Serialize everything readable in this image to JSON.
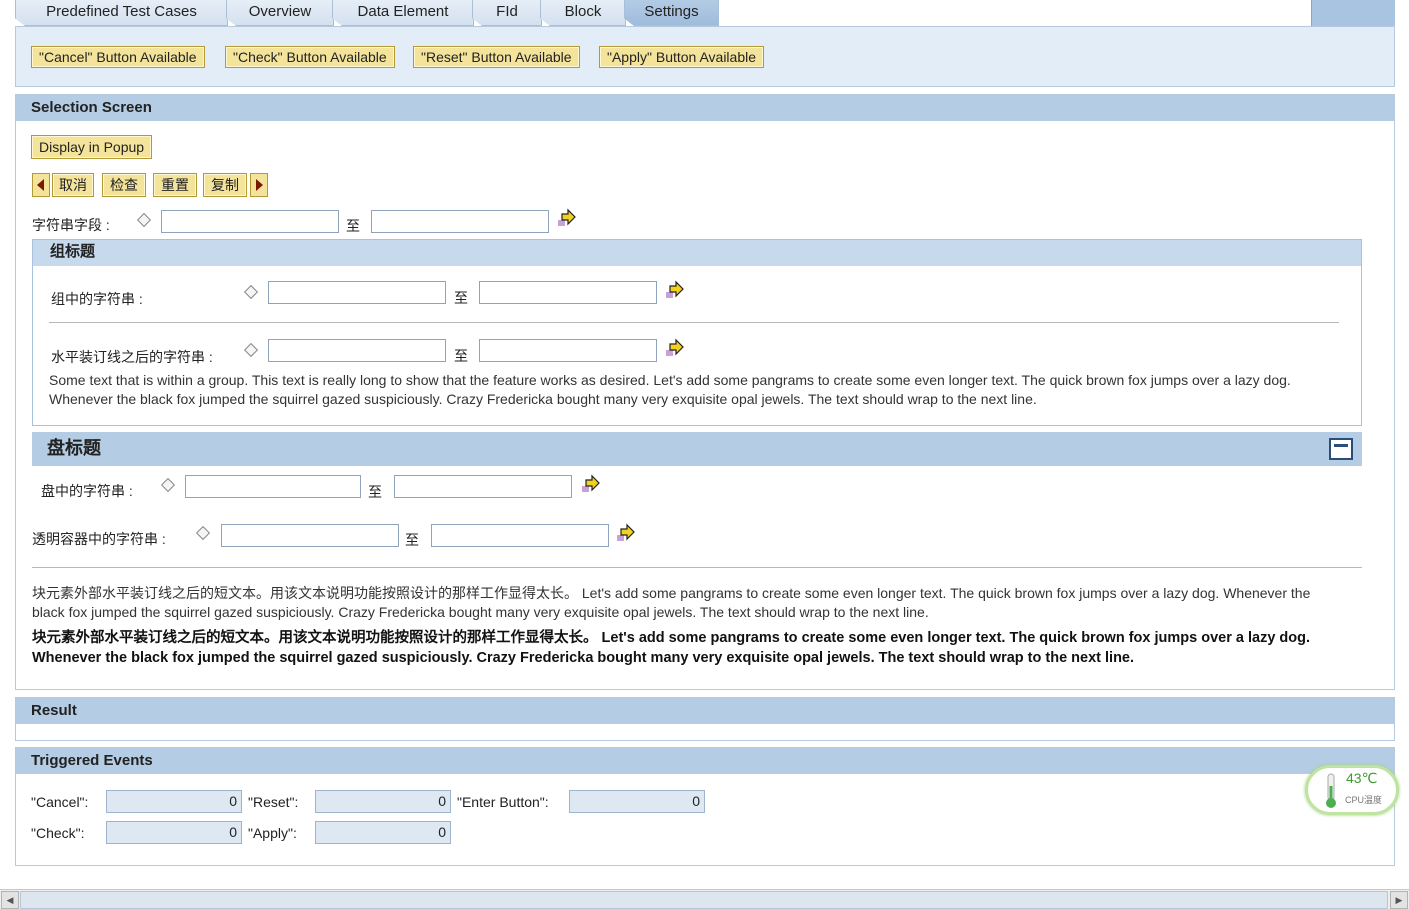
{
  "tabs": [
    {
      "label": "Predefined Test Cases"
    },
    {
      "label": "Overview"
    },
    {
      "label": "Data Element"
    },
    {
      "label": "FId"
    },
    {
      "label": "Block"
    },
    {
      "label": "Settings"
    }
  ],
  "toolbar": {
    "buttons": [
      "\"Cancel\" Button Available",
      "\"Check\" Button Available",
      "\"Reset\" Button Available",
      "\"Apply\" Button Available"
    ]
  },
  "selection": {
    "title": "Selection Screen",
    "popup_button": "Display in Popup",
    "nav_buttons": [
      "取消",
      "检查",
      "重置",
      "复制"
    ],
    "string_field_label": "字符串字段 :",
    "to": "至",
    "group": {
      "title": "组标题",
      "field1_label": "组中的字符串 :",
      "field2_label": "水平装订线之后的字符串 :",
      "text": "Some text that is within a group. This text is really long to show that the feature works as desired. Let's add some pangrams to create some even longer text. The quick brown fox jumps over a lazy dog. Whenever the black fox jumped the squirrel gazed suspiciously. Crazy Fredericka bought many very exquisite opal jewels. The text should wrap to the next line."
    },
    "tray": {
      "title": "盘标题",
      "field1_label": "盘中的字符串 :",
      "field2_label": "透明容器中的字符串 :"
    },
    "block_text_normal": "块元素外部水平装订线之后的短文本。用该文本说明功能按照设计的那样工作显得太长。 Let's add some pangrams to create some even longer text. The quick brown fox jumps over a lazy dog. Whenever the black fox jumped the squirrel gazed suspiciously. Crazy Fredericka bought many very exquisite opal jewels. The text should wrap to the next line.",
    "block_text_bold": "块元素外部水平装订线之后的短文本。用该文本说明功能按照设计的那样工作显得太长。 Let's add some pangrams to create some even longer text. The quick brown fox jumps over a lazy dog. Whenever the black fox jumped the squirrel gazed suspiciously. Crazy Fredericka bought many very exquisite opal jewels. The text should wrap to the next line."
  },
  "result": {
    "title": "Result"
  },
  "events": {
    "title": "Triggered Events",
    "cancel_label": "\"Cancel\":",
    "cancel_value": "0",
    "reset_label": "\"Reset\":",
    "reset_value": "0",
    "enter_label": "\"Enter Button\":",
    "enter_value": "0",
    "check_label": "\"Check\":",
    "check_value": "0",
    "apply_label": "\"Apply\":",
    "apply_value": "0"
  },
  "cpu_widget": {
    "temp": "43℃",
    "label": "CPU温度"
  },
  "colors": {
    "header_blue": "#b4cce4",
    "button_yellow": "#f4e49b",
    "arrow_yellow": "#f2d21c"
  }
}
